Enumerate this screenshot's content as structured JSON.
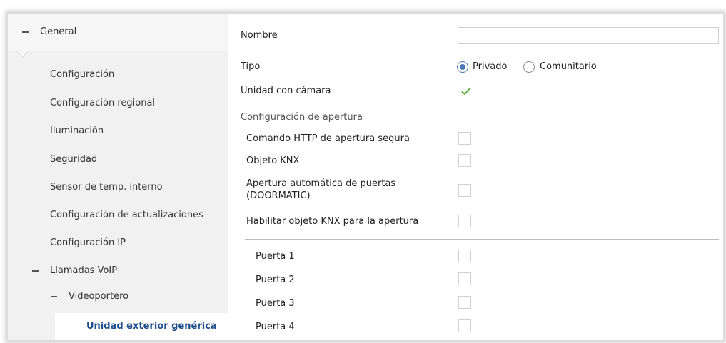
{
  "sidebar": {
    "header": "General",
    "items": [
      {
        "label": "Configuración"
      },
      {
        "label": "Configuración regional"
      },
      {
        "label": "Iluminación"
      },
      {
        "label": "Seguridad"
      },
      {
        "label": "Sensor de temp. interno"
      },
      {
        "label": "Configuración de actualizaciones"
      },
      {
        "label": "Configuración IP"
      },
      {
        "label": "Llamadas VoIP"
      },
      {
        "label": "Videoportero"
      },
      {
        "label": "Unidad exterior genérica"
      }
    ]
  },
  "form": {
    "nombre_label": "Nombre",
    "nombre_value": "",
    "tipo_label": "Tipo",
    "tipo_options": [
      "Privado",
      "Comunitario"
    ],
    "tipo_selected": "Privado",
    "camara_label": "Unidad con cámara",
    "camara_checked": true,
    "apertura_section": "Configuración de apertura",
    "apertura_items": [
      {
        "label": "Comando HTTP de apertura segura",
        "checked": false
      },
      {
        "label": "Objeto KNX",
        "checked": false
      },
      {
        "label_line1": "Apertura automática de puertas",
        "label_line2": "(DOORMATIC)",
        "checked": false
      },
      {
        "label": "Habilitar objeto KNX para la apertura",
        "checked": false
      }
    ],
    "puertas": [
      {
        "label": "Puerta 1",
        "checked": false
      },
      {
        "label": "Puerta 2",
        "checked": false
      },
      {
        "label": "Puerta 3",
        "checked": false
      },
      {
        "label": "Puerta 4",
        "checked": false
      }
    ]
  },
  "colors": {
    "accent": "#1f4e8c",
    "radio": "#4a78b8",
    "check": "#5cab3e",
    "sidebar_bg": "#f1f1f1"
  },
  "icons": {
    "collapse": "minus-icon",
    "check": "checkmark-icon"
  }
}
